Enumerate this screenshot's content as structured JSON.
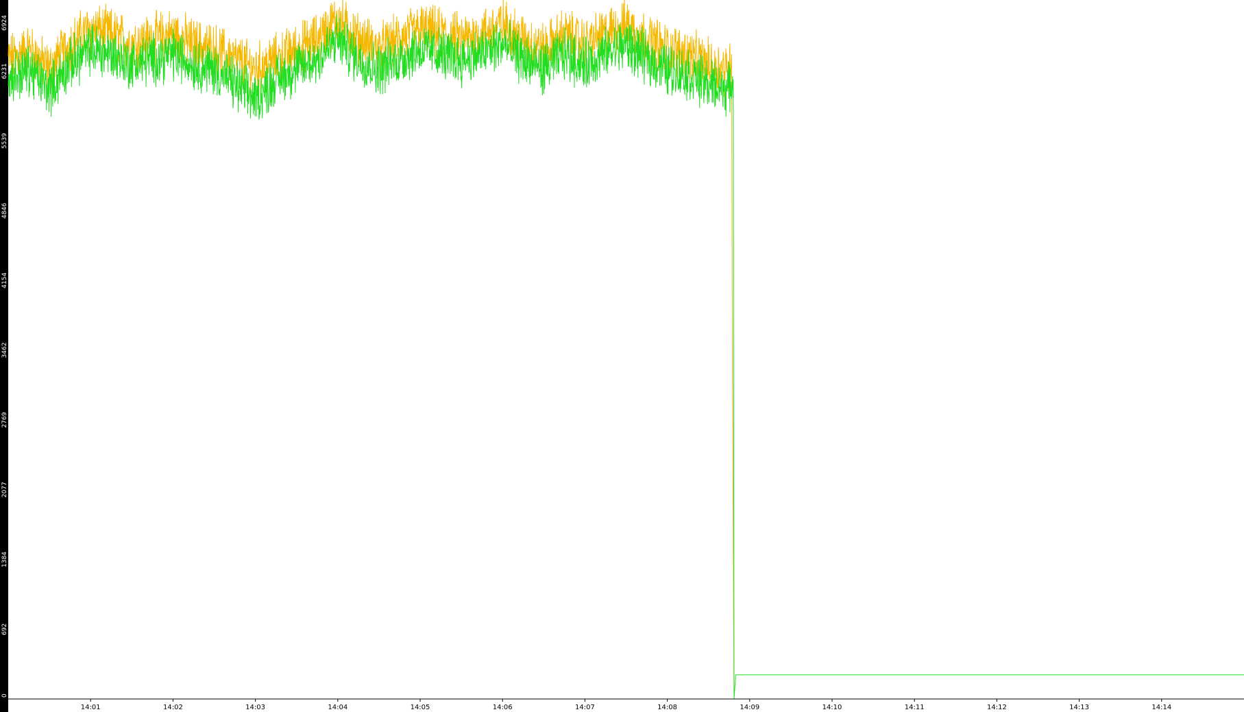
{
  "chart_data": {
    "type": "line",
    "title": "",
    "xlabel": "",
    "ylabel": "",
    "x_unit": "minutes",
    "xlim": [
      0,
      15.0
    ],
    "ylim": [
      0,
      6924
    ],
    "y_ticks": [
      0,
      692,
      1384,
      2077,
      2769,
      3462,
      4154,
      4846,
      5539,
      6231,
      6924
    ],
    "x_ticks": [
      {
        "value": 1,
        "label": "14:01"
      },
      {
        "value": 2,
        "label": "14:02"
      },
      {
        "value": 3,
        "label": "14:03"
      },
      {
        "value": 4,
        "label": "14:04"
      },
      {
        "value": 5,
        "label": "14:05"
      },
      {
        "value": 6,
        "label": "14:06"
      },
      {
        "value": 7,
        "label": "14:07"
      },
      {
        "value": 8,
        "label": "14:08"
      },
      {
        "value": 9,
        "label": "14:09"
      },
      {
        "value": 10,
        "label": "14:10"
      },
      {
        "value": 11,
        "label": "14:11"
      },
      {
        "value": 12,
        "label": "14:12"
      },
      {
        "value": 13,
        "label": "14:13"
      },
      {
        "value": 14,
        "label": "14:14"
      }
    ],
    "grid": false,
    "legend": "none",
    "colors": {
      "background": "#ffffff",
      "axis_band": "#000000",
      "axis_text": "#ffffff",
      "tick_text": "#000000"
    },
    "series": [
      {
        "color": "#f5b800",
        "x": [
          0.0,
          0.25,
          0.5,
          0.75,
          1.0,
          1.25,
          1.5,
          1.75,
          2.0,
          2.25,
          2.5,
          2.75,
          3.0,
          3.25,
          3.5,
          3.75,
          4.0,
          4.25,
          4.5,
          4.75,
          5.0,
          5.25,
          5.5,
          5.75,
          6.0,
          6.25,
          6.5,
          6.75,
          7.0,
          7.25,
          7.5,
          7.75,
          8.0,
          8.25,
          8.5,
          8.75,
          8.78,
          8.79,
          8.81
        ],
        "y": [
          6350,
          6450,
          6250,
          6500,
          6650,
          6600,
          6500,
          6550,
          6600,
          6500,
          6450,
          6350,
          6250,
          6350,
          6450,
          6550,
          6750,
          6550,
          6450,
          6550,
          6650,
          6600,
          6550,
          6600,
          6700,
          6550,
          6450,
          6600,
          6500,
          6600,
          6700,
          6550,
          6450,
          6400,
          6300,
          6250,
          6400,
          3150,
          0
        ]
      },
      {
        "color": "#22dd22",
        "x": [
          0.0,
          0.25,
          0.5,
          0.75,
          1.0,
          1.25,
          1.5,
          1.75,
          2.0,
          2.25,
          2.5,
          2.75,
          3.0,
          3.25,
          3.5,
          3.75,
          4.0,
          4.25,
          4.5,
          4.75,
          5.0,
          5.25,
          5.5,
          5.75,
          6.0,
          6.25,
          6.5,
          6.75,
          7.0,
          7.25,
          7.5,
          7.75,
          8.0,
          8.25,
          8.5,
          8.75,
          8.8,
          8.81,
          8.83,
          10.0,
          11.0,
          12.0,
          13.0,
          14.0,
          15.0
        ],
        "y": [
          6150,
          6250,
          6050,
          6300,
          6450,
          6400,
          6300,
          6350,
          6400,
          6300,
          6250,
          6100,
          5950,
          6150,
          6250,
          6350,
          6550,
          6350,
          6250,
          6350,
          6450,
          6400,
          6350,
          6400,
          6500,
          6350,
          6250,
          6400,
          6300,
          6400,
          6500,
          6350,
          6250,
          6200,
          6100,
          6050,
          6150,
          0,
          240,
          240,
          240,
          240,
          240,
          240,
          240
        ]
      }
    ]
  }
}
